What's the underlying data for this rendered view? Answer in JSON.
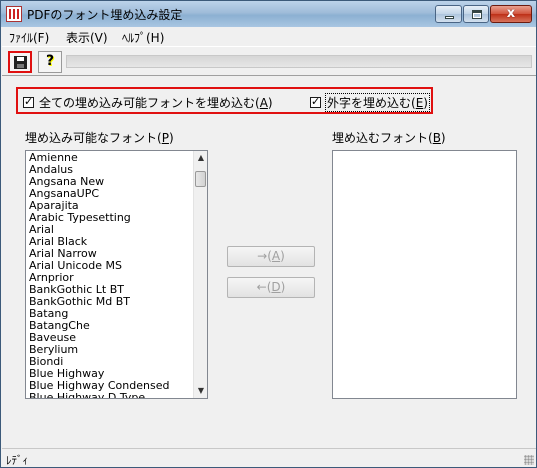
{
  "window": {
    "title": "PDFのフォント埋め込み設定",
    "controls": {
      "minimize_icon": "minimize-icon",
      "maximize_icon": "maximize-icon",
      "close_glyph": "x"
    }
  },
  "menu": {
    "items": [
      {
        "label": "ﾌｧｲﾙ(F)"
      },
      {
        "label": "表示(V)"
      },
      {
        "label": "ﾍﾙﾌﾟ(H)"
      }
    ]
  },
  "toolbar": {
    "save_icon": "save-disk-icon",
    "help_icon": "help-question-icon",
    "help_glyph": "?"
  },
  "options": {
    "embed_all": {
      "label": "全ての埋め込み可能フォントを埋め込む(",
      "key": "A",
      "suffix": ")",
      "checked": true
    },
    "embed_gaiji": {
      "label": "外字を埋め込む(",
      "key": "E",
      "suffix": ")",
      "checked": true
    }
  },
  "available_list": {
    "label_pre": "埋め込み可能なフォント(",
    "label_key": "P",
    "label_post": ")",
    "items": [
      "Amienne",
      "Andalus",
      "Angsana New",
      "AngsanaUPC",
      "Aparajita",
      "Arabic Typesetting",
      "Arial",
      "Arial Black",
      "Arial Narrow",
      "Arial Unicode MS",
      "Arnprior",
      "BankGothic Lt BT",
      "BankGothic Md BT",
      "Batang",
      "BatangChe",
      "Baveuse",
      "Berylium",
      "Biondi",
      "Blue Highway",
      "Blue Highway Condensed",
      "Blue Highway D Type"
    ],
    "scroll_up": "▲",
    "scroll_down": "▼"
  },
  "embed_list": {
    "label_pre": "埋め込むフォント(",
    "label_key": "B",
    "label_post": ")",
    "items": []
  },
  "buttons": {
    "add": {
      "pre": "→(",
      "key": "A",
      "post": ")"
    },
    "remove": {
      "pre": "←(",
      "key": "D",
      "post": ")"
    }
  },
  "status": {
    "text": "ﾚﾃﾞｨ"
  }
}
